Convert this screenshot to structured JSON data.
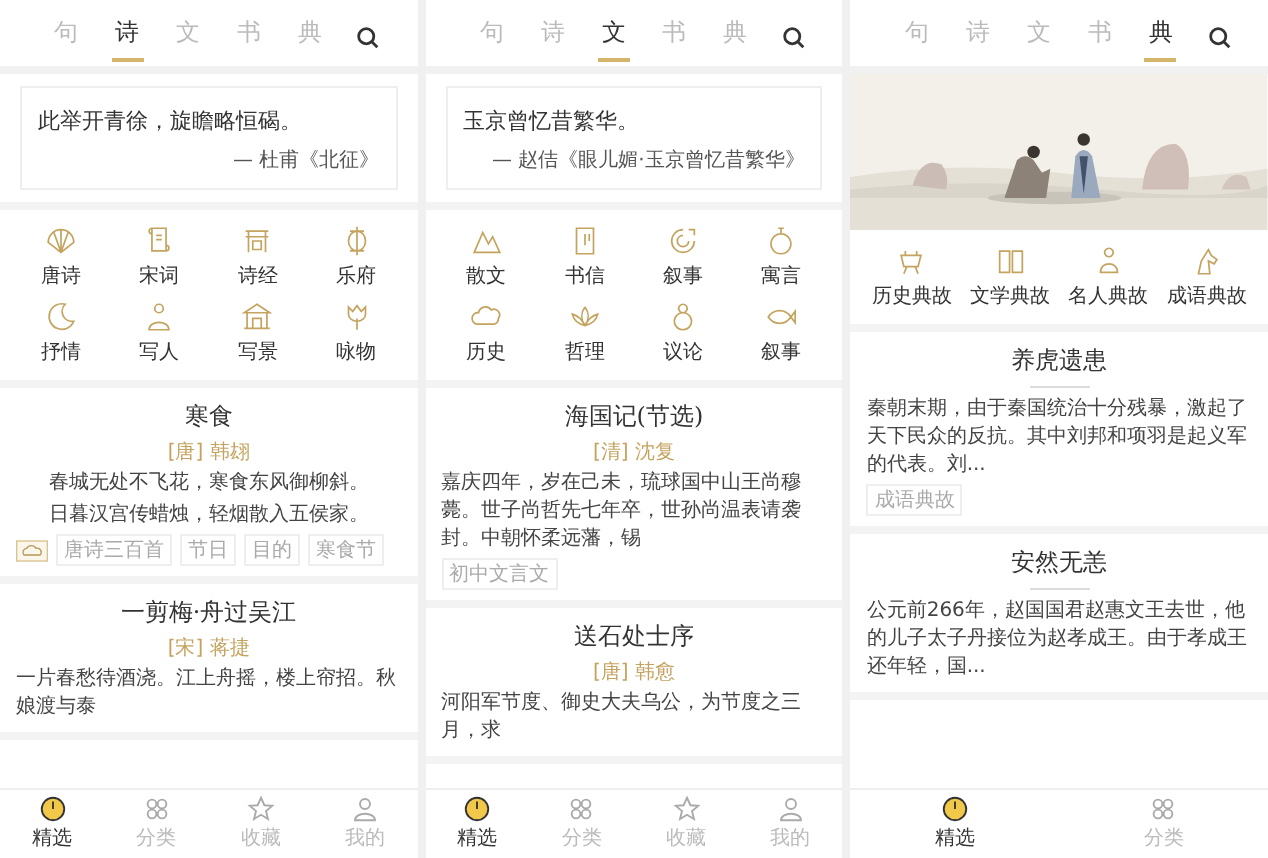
{
  "panels": [
    {
      "tabs": [
        {
          "label": "句",
          "selected": false
        },
        {
          "label": "诗",
          "selected": true
        },
        {
          "label": "文",
          "selected": false
        },
        {
          "label": "书",
          "selected": false
        },
        {
          "label": "典",
          "selected": false
        }
      ],
      "top": {
        "kind": "quote",
        "text": "此举开青徐，旋瞻略恒碣。",
        "source": "— 杜甫《北征》"
      },
      "categories": [
        "唐诗",
        "宋词",
        "诗经",
        "乐府",
        "抒情",
        "写人",
        "写景",
        "咏物"
      ],
      "articles": [
        {
          "kind": "poem",
          "title": "寒食",
          "author": "[唐] 韩翃",
          "lines": [
            "春城无处不飞花，寒食东风御柳斜。",
            "日暮汉宫传蜡烛，轻烟散入五侯家。"
          ],
          "tags": [
            "唐诗三百首",
            "节日",
            "目的",
            "寒食节"
          ]
        },
        {
          "kind": "prose",
          "title": "一剪梅·舟过吴江",
          "author": "[宋] 蒋捷",
          "lines": [
            "一片春愁待酒浇。江上舟摇，楼上帘招。秋娘渡与泰"
          ]
        }
      ],
      "nav": [
        {
          "label": "精选",
          "selected": true
        },
        {
          "label": "分类",
          "selected": false
        },
        {
          "label": "收藏",
          "selected": false
        },
        {
          "label": "我的",
          "selected": false
        }
      ]
    },
    {
      "tabs": [
        {
          "label": "句",
          "selected": false
        },
        {
          "label": "诗",
          "selected": false
        },
        {
          "label": "文",
          "selected": true
        },
        {
          "label": "书",
          "selected": false
        },
        {
          "label": "典",
          "selected": false
        }
      ],
      "top": {
        "kind": "quote",
        "text": "玉京曾忆昔繁华。",
        "source": "— 赵佶《眼儿媚·玉京曾忆昔繁华》"
      },
      "categories": [
        "散文",
        "书信",
        "叙事",
        "寓言",
        "历史",
        "哲理",
        "议论",
        "叙事"
      ],
      "articles": [
        {
          "kind": "prose",
          "title": "海国记(节选)",
          "author": "[清] 沈复",
          "lines": [
            "嘉庆四年，岁在己未，琉球国中山王尚穆薨。世子尚哲先七年卒，世孙尚温表请袭封。中朝怀柔远藩，锡"
          ],
          "tags": [
            "初中文言文"
          ]
        },
        {
          "kind": "prose",
          "title": "送石处士序",
          "author": "[唐] 韩愈",
          "lines": [
            "河阳军节度、御史大夫乌公，为节度之三月，求"
          ]
        }
      ],
      "nav": [
        {
          "label": "精选",
          "selected": true
        },
        {
          "label": "分类",
          "selected": false
        },
        {
          "label": "收藏",
          "selected": false
        },
        {
          "label": "我的",
          "selected": false
        }
      ]
    },
    {
      "tabs": [
        {
          "label": "句",
          "selected": false
        },
        {
          "label": "诗",
          "selected": false
        },
        {
          "label": "文",
          "selected": false
        },
        {
          "label": "书",
          "selected": false
        },
        {
          "label": "典",
          "selected": true
        }
      ],
      "top": {
        "kind": "picture"
      },
      "categories": [
        "历史典故",
        "文学典故",
        "名人典故",
        "成语典故"
      ],
      "articles": [
        {
          "kind": "story",
          "title": "养虎遗患",
          "lines": [
            "秦朝末期，由于秦国统治十分残暴，激起了天下民众的反抗。其中刘邦和项羽是起义军的代表。刘..."
          ],
          "tags": [
            "成语典故"
          ]
        },
        {
          "kind": "story",
          "title": "安然无恙",
          "lines": [
            "公元前266年，赵国国君赵惠文王去世，他的儿子太子丹接位为赵孝成王。由于孝成王还年轻，国..."
          ]
        }
      ],
      "nav": [
        {
          "label": "精选",
          "selected": true
        },
        {
          "label": "分类",
          "selected": false
        }
      ]
    }
  ]
}
